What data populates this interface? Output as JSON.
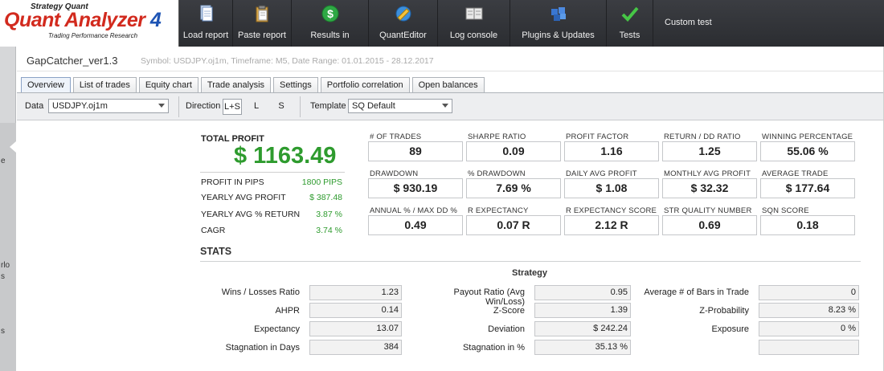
{
  "app": {
    "logo_line1": "Strategy Quant",
    "logo_line2": "Quant Analyzer",
    "logo_version": "4",
    "logo_line3": "Trading Performance     Research"
  },
  "toolbar": {
    "load_report": "Load report",
    "paste_report": "Paste report",
    "results_in": "Results in",
    "quant_editor": "QuantEditor",
    "log_console": "Log console",
    "plugins_updates": "Plugins & Updates",
    "tests": "Tests",
    "custom_test": "Custom test"
  },
  "rail": {
    "t1": "e",
    "t2": "rlo",
    "t3": "s",
    "t4": "s"
  },
  "doc": {
    "title": "GapCatcher_ver1.3",
    "meta": "Symbol: USDJPY.oj1m, Timeframe: M5, Date Range: 01.01.2015 - 28.12.2017"
  },
  "tabs": [
    "Overview",
    "List of trades",
    "Equity chart",
    "Trade analysis",
    "Settings",
    "Portfolio correlation",
    "Open balances"
  ],
  "filters": {
    "data_label": "Data",
    "data_value": "USDJPY.oj1m",
    "direction_label": "Direction",
    "dir_both": "L+S",
    "dir_long": "L",
    "dir_short": "S",
    "template_label": "Template",
    "template_value": "SQ Default"
  },
  "summary": {
    "total_profit_label": "TOTAL PROFIT",
    "total_profit_value": "$ 1163.49",
    "rows": [
      {
        "label": "PROFIT IN PIPS",
        "value": "1800 PIPS"
      },
      {
        "label": "YEARLY AVG PROFIT",
        "value": "$ 387.48"
      },
      {
        "label": "YEARLY AVG % RETURN",
        "value": "3.87 %"
      },
      {
        "label": "CAGR",
        "value": "3.74 %"
      }
    ]
  },
  "metrics": [
    {
      "label": "# OF TRADES",
      "value": "89"
    },
    {
      "label": "SHARPE RATIO",
      "value": "0.09"
    },
    {
      "label": "PROFIT FACTOR",
      "value": "1.16"
    },
    {
      "label": "RETURN / DD RATIO",
      "value": "1.25"
    },
    {
      "label": "WINNING PERCENTAGE",
      "value": "55.06 %"
    },
    {
      "label": "DRAWDOWN",
      "value": "$ 930.19"
    },
    {
      "label": "% DRAWDOWN",
      "value": "7.69 %"
    },
    {
      "label": "DAILY AVG PROFIT",
      "value": "$ 1.08"
    },
    {
      "label": "MONTHLY AVG PROFIT",
      "value": "$ 32.32"
    },
    {
      "label": "AVERAGE TRADE",
      "value": "$ 177.64"
    },
    {
      "label": "ANNUAL % / MAX DD %",
      "value": "0.49"
    },
    {
      "label": "R EXPECTANCY",
      "value": "0.07 R"
    },
    {
      "label": "R EXPECTANCY SCORE",
      "value": "2.12 R"
    },
    {
      "label": "STR QUALITY NUMBER",
      "value": "0.69"
    },
    {
      "label": "SQN SCORE",
      "value": "0.18"
    }
  ],
  "stats": {
    "title": "STATS",
    "subtitle": "Strategy",
    "col1": [
      {
        "label": "Wins / Losses Ratio",
        "value": "1.23"
      },
      {
        "label": "AHPR",
        "value": "0.14"
      },
      {
        "label": "Expectancy",
        "value": "13.07"
      },
      {
        "label": "Stagnation in Days",
        "value": "384"
      }
    ],
    "col2": [
      {
        "label": "Payout Ratio (Avg Win/Loss)",
        "value": "0.95"
      },
      {
        "label": "Z-Score",
        "value": "1.39"
      },
      {
        "label": "Deviation",
        "value": "$ 242.24"
      },
      {
        "label": "Stagnation in %",
        "value": "35.13 %"
      }
    ],
    "col3": [
      {
        "label": "Average # of Bars in Trade",
        "value": "0"
      },
      {
        "label": "Z-Probability",
        "value": "8.23 %"
      },
      {
        "label": "Exposure",
        "value": "0 %"
      },
      {
        "label": "",
        "value": ""
      }
    ]
  },
  "colors": {
    "profit_green": "#2e9b2e",
    "toolbar_dark": "#2b2d31",
    "logo_red": "#d22a1e",
    "logo_blue": "#1e54b4"
  },
  "icons": {
    "load_report": "document-icon",
    "paste_report": "clipboard-icon",
    "results_in": "dollar-icon",
    "quant_editor": "editor-globe-icon",
    "log_console": "book-icon",
    "plugins_updates": "puzzle-icon",
    "tests": "checkmark-icon"
  }
}
